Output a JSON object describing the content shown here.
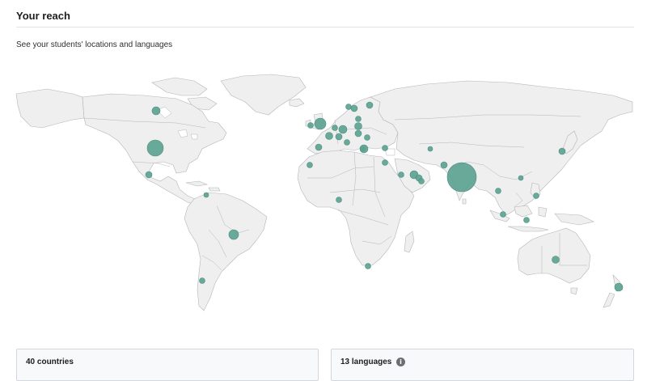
{
  "header": {
    "title": "Your reach",
    "subtitle": "See your students' locations and languages"
  },
  "map": {
    "bubble_color": "#5aa190",
    "land_color": "#efefef",
    "border_color": "#b3b5b8"
  },
  "cards": {
    "countries_label": "40 countries",
    "languages_label": "13 languages",
    "info_icon": "info-icon"
  }
}
